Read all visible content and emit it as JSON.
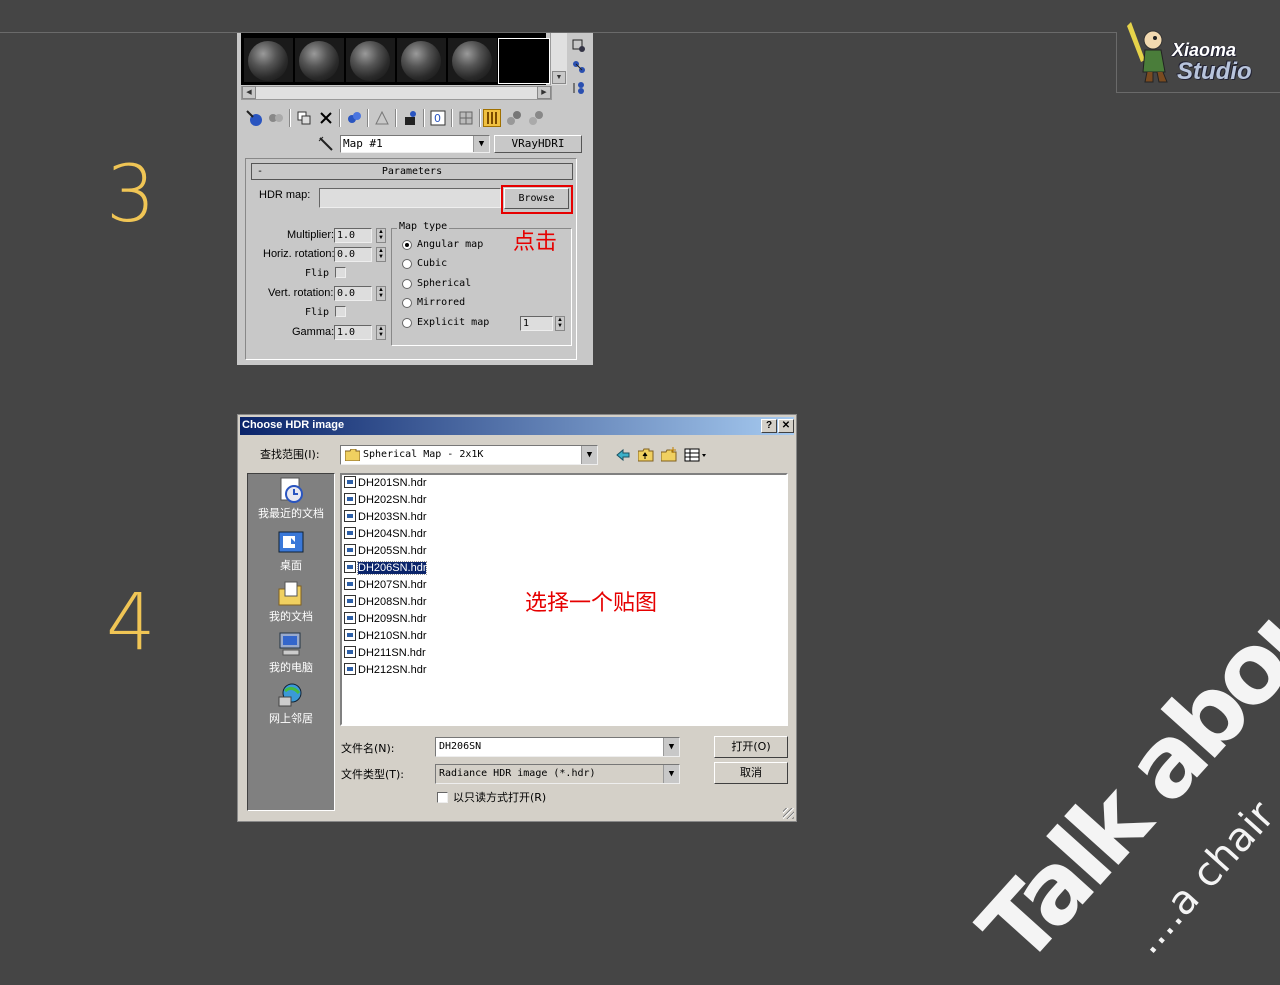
{
  "logo": {
    "line1": "Xiaoma",
    "line2": "Studio"
  },
  "steps": {
    "three": "3",
    "four": "4"
  },
  "watermark": {
    "main": "Talk about",
    "sub": "....a chair"
  },
  "material_editor": {
    "map_name": "Map #1",
    "map_type_button": "VRayHDRI",
    "rollout_title": "Parameters",
    "rollout_minus": "-",
    "hdr_map_label": "HDR map:",
    "hdr_map_value": "",
    "browse_label": "Browse",
    "annotation_click": "点击",
    "multiplier_label": "Multiplier:",
    "multiplier_value": "1.0",
    "horiz_rotation_label": "Horiz. rotation:",
    "horiz_rotation_value": "0.0",
    "flip_label": "Flip",
    "vert_rotation_label": "Vert. rotation:",
    "vert_rotation_value": "0.0",
    "flip2_label": "Flip",
    "gamma_label": "Gamma:",
    "gamma_value": "1.0",
    "map_type_title": "Map type",
    "map_types": [
      "Angular map",
      "Cubic",
      "Spherical",
      "Mirrored",
      "Explicit map"
    ],
    "map_type_selected": "Angular map",
    "explicit_channel": "1"
  },
  "dialog": {
    "title": "Choose HDR image",
    "help_btn": "?",
    "close_btn": "✕",
    "look_in_label": "查找范围(I):",
    "look_in_value": "Spherical Map - 2x1K",
    "places": [
      "我最近的文档",
      "桌面",
      "我的文档",
      "我的电脑",
      "网上邻居"
    ],
    "files": [
      "DH201SN.hdr",
      "DH202SN.hdr",
      "DH203SN.hdr",
      "DH204SN.hdr",
      "DH205SN.hdr",
      "DH206SN.hdr",
      "DH207SN.hdr",
      "DH208SN.hdr",
      "DH209SN.hdr",
      "DH210SN.hdr",
      "DH211SN.hdr",
      "DH212SN.hdr"
    ],
    "selected_file": "DH206SN.hdr",
    "annotation_select": "选择一个贴图",
    "filename_label": "文件名(N):",
    "filename_value": "DH206SN",
    "filetype_label": "文件类型(T):",
    "filetype_value": "Radiance HDR image (*.hdr)",
    "readonly_label": "以只读方式打开(R)",
    "open_btn": "打开(O)",
    "cancel_btn": "取消"
  },
  "colors": {
    "background": "#454545",
    "step_numbers": "#f0c555",
    "annotation": "#e60000",
    "title_bar": "#0a246a"
  }
}
